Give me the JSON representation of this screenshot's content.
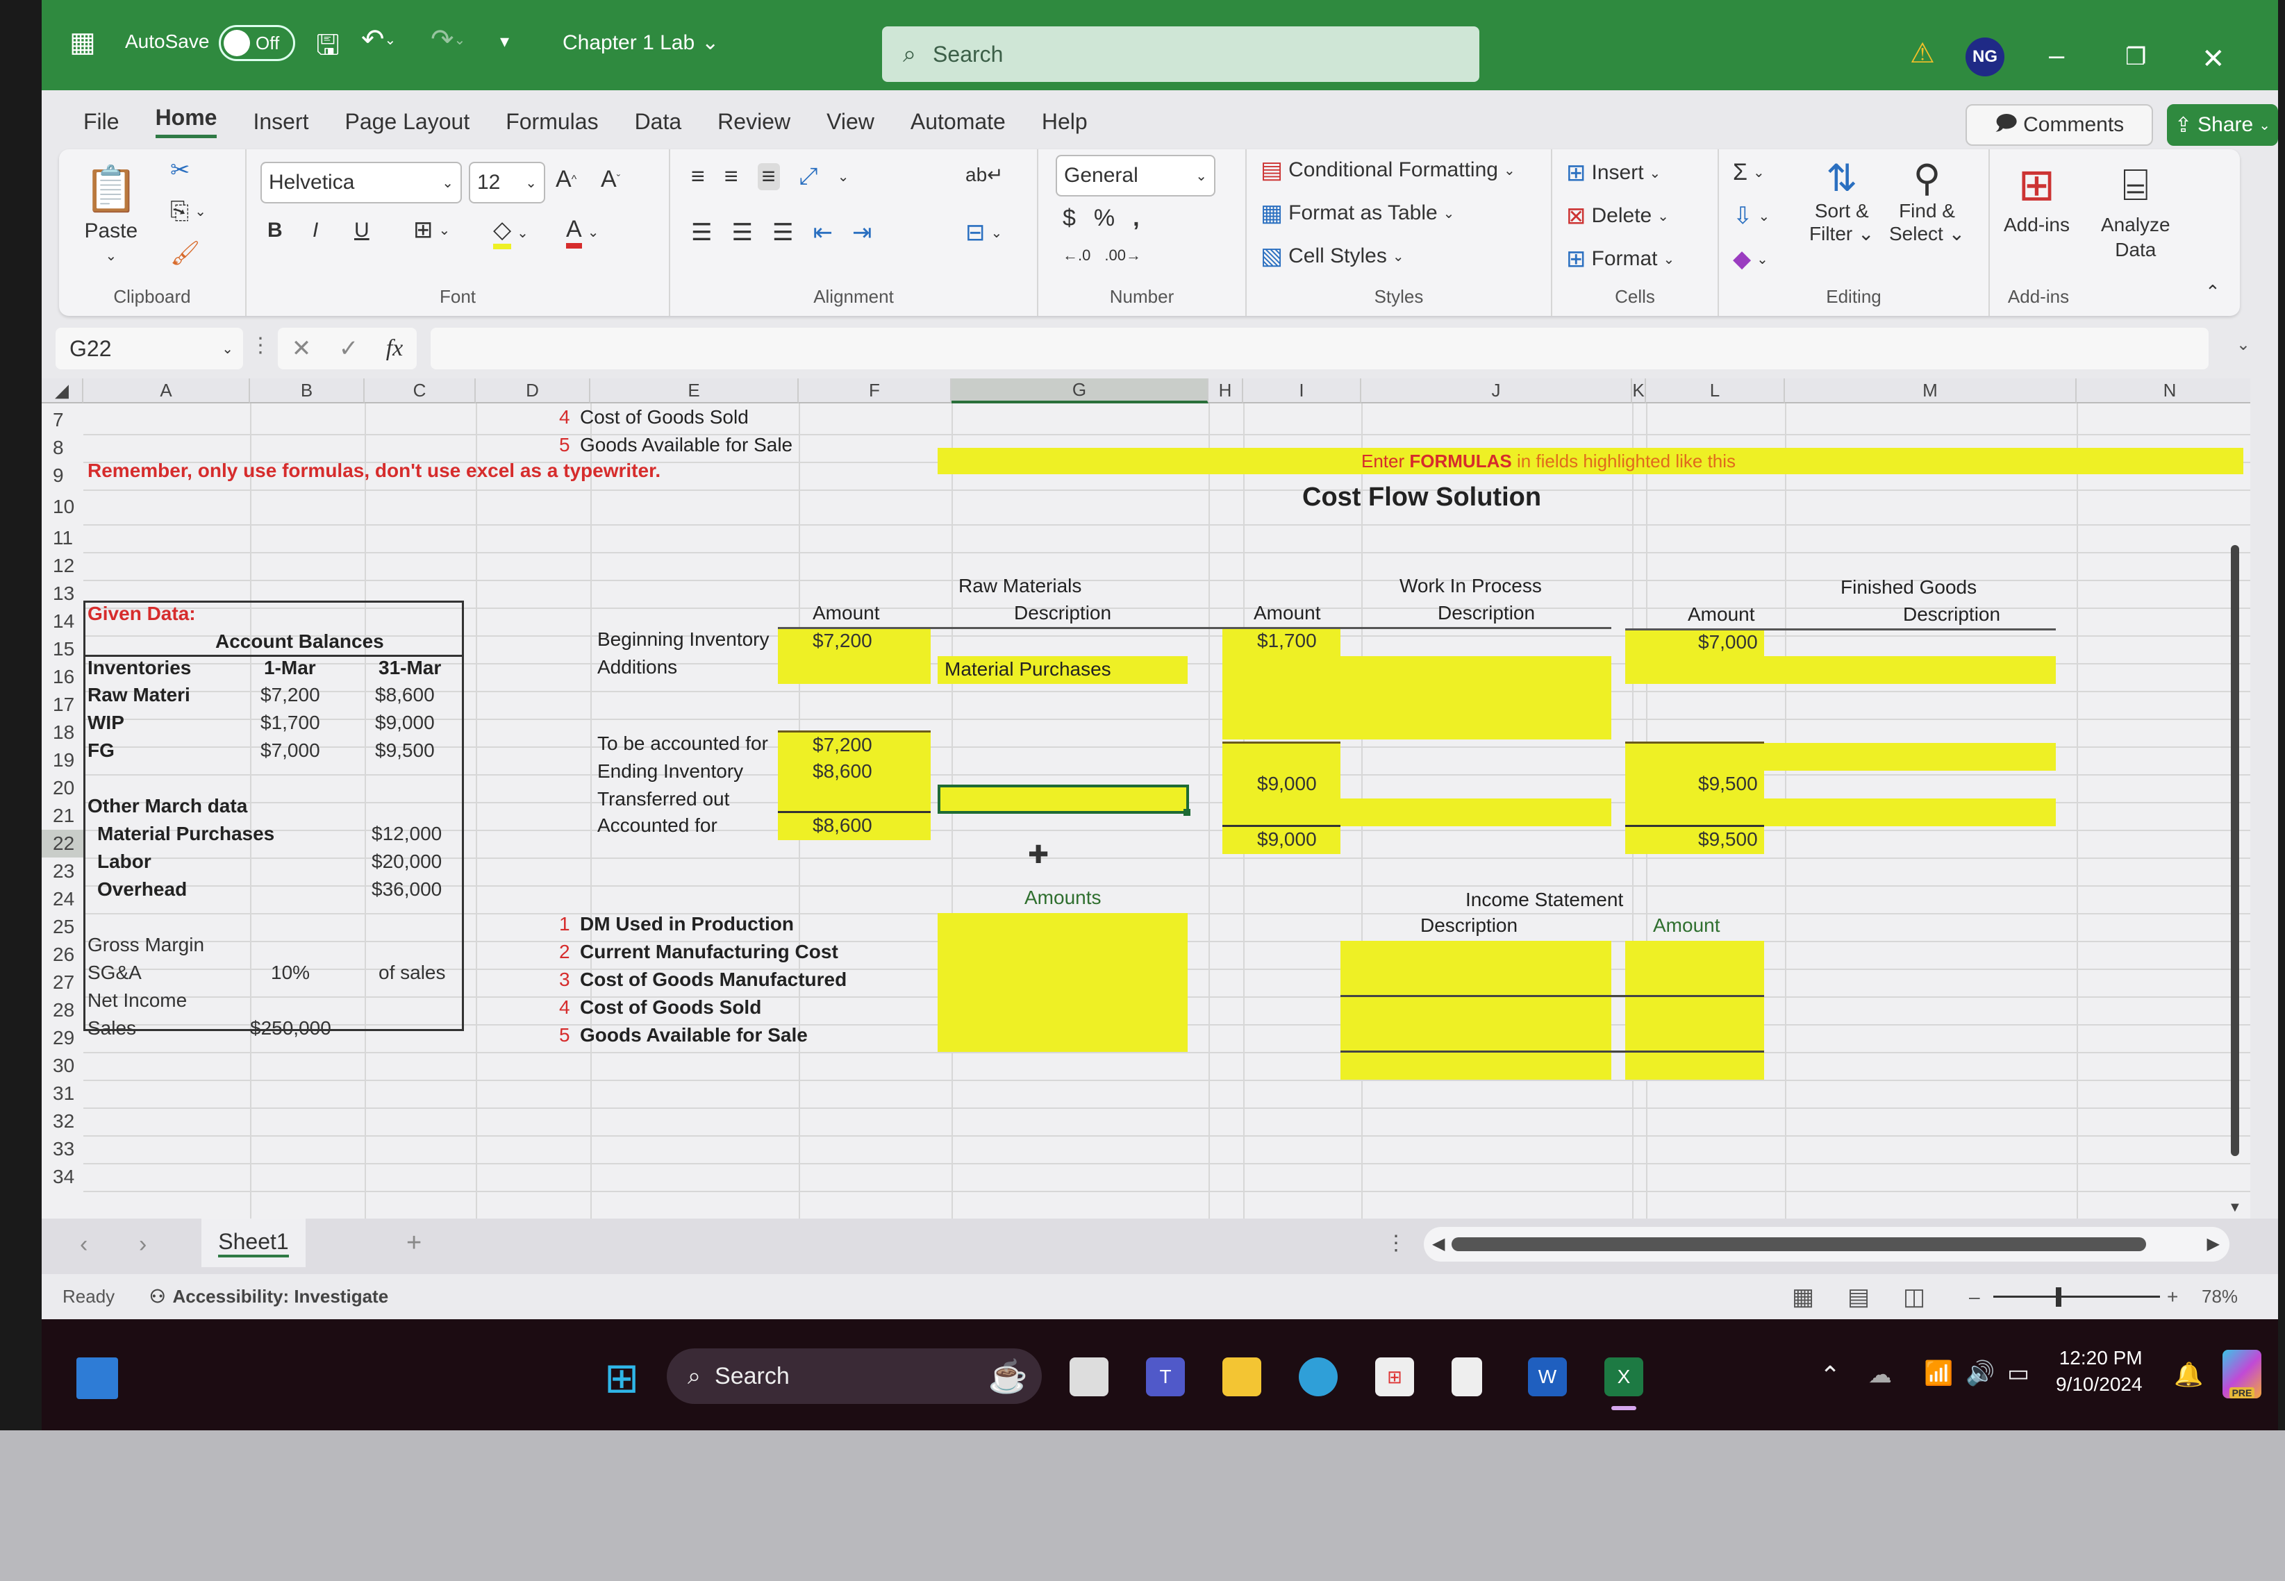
{
  "titlebar": {
    "autosave_label": "AutoSave",
    "autosave_state": "Off",
    "document_title": "Chapter 1 Lab",
    "search_placeholder": "Search",
    "user_initials": "NG",
    "icons": [
      "excel-logo-icon",
      "save-icon",
      "undo-icon",
      "redo-icon",
      "customize-qat-icon",
      "warning-icon",
      "minimize-icon",
      "restore-icon",
      "close-icon"
    ]
  },
  "menu": {
    "tabs": [
      "File",
      "Home",
      "Insert",
      "Page Layout",
      "Formulas",
      "Data",
      "Review",
      "View",
      "Automate",
      "Help"
    ],
    "active_tab": "Home",
    "comments_label": "Comments",
    "share_label": "Share"
  },
  "ribbon": {
    "clipboard": {
      "paste_label": "Paste",
      "group_label": "Clipboard"
    },
    "font": {
      "font_name": "Helvetica",
      "font_size": "12",
      "group_label": "Font",
      "bold": "B",
      "italic": "I",
      "underline": "U"
    },
    "alignment": {
      "group_label": "Alignment"
    },
    "number": {
      "format": "General",
      "currency": "$",
      "percent": "%",
      "comma": ",",
      "group_label": "Number"
    },
    "styles": {
      "conditional_formatting": "Conditional Formatting",
      "format_as_table": "Format as Table",
      "cell_styles": "Cell Styles",
      "group_label": "Styles"
    },
    "cells": {
      "insert": "Insert",
      "delete": "Delete",
      "format": "Format",
      "group_label": "Cells"
    },
    "editing": {
      "sort_filter_1": "Sort &",
      "sort_filter_2": "Filter",
      "find_select_1": "Find &",
      "find_select_2": "Select",
      "group_label": "Editing"
    },
    "addins": {
      "addins_label": "Add-ins",
      "analyze_1": "Analyze",
      "analyze_2": "Data",
      "group_label": "Add-ins"
    }
  },
  "formula_bar": {
    "name_box": "G22",
    "formula": ""
  },
  "grid": {
    "columns": [
      "A",
      "B",
      "C",
      "D",
      "E",
      "F",
      "G",
      "H",
      "I",
      "J",
      "K",
      "L",
      "M",
      "N"
    ],
    "selected_column": "G",
    "rows": [
      "7",
      "8",
      "9",
      "10",
      "11",
      "12",
      "13",
      "14",
      "15",
      "16",
      "17",
      "18",
      "19",
      "20",
      "21",
      "22",
      "23",
      "24",
      "25",
      "26",
      "27",
      "28",
      "29",
      "30",
      "31",
      "32",
      "33",
      "34"
    ],
    "selected_cell": "G22"
  },
  "sheet": {
    "top_list": [
      {
        "num": "4",
        "label": "Cost of Goods Sold"
      },
      {
        "num": "5",
        "label": "Goods Available for Sale"
      }
    ],
    "reminder": "Remember, only use formulas, don't use excel as a typewriter.",
    "banner_prefix": "Enter",
    "banner_bold": "FORMULAS",
    "banner_suffix": "in fields highlighted like this",
    "title": "Cost Flow Solution",
    "given": {
      "heading": "Given Data:",
      "account_balances": "Account Balances",
      "inventories_hdr": "Inventories",
      "col1": "1-Mar",
      "col2": "31-Mar",
      "rows": [
        {
          "label": "Raw Materi",
          "mar1": "$7,200",
          "mar31": "$8,600"
        },
        {
          "label": "WIP",
          "mar1": "$1,700",
          "mar31": "$9,000"
        },
        {
          "label": "FG",
          "mar1": "$7,000",
          "mar31": "$9,500"
        }
      ],
      "other_heading": "Other March data",
      "other": [
        {
          "label": "Material Purchases",
          "value": "$12,000"
        },
        {
          "label": "Labor",
          "value": "$20,000"
        },
        {
          "label": "Overhead",
          "value": "$36,000"
        }
      ],
      "gross_margin": "Gross Margin",
      "sga_label": "SG&A",
      "sga_pct": "10%",
      "sga_of": "of sales",
      "net_income": "Net Income",
      "sales_label": "Sales",
      "sales_value": "$250,000"
    },
    "flow_labels": {
      "beginning": "Beginning Inventory",
      "additions": "Additions",
      "to_be_accounted": "To be accounted for",
      "ending": "Ending Inventory",
      "transferred": "Transferred out",
      "accounted": "Accounted for"
    },
    "raw_materials": {
      "title": "Raw Materials",
      "amount_hdr": "Amount",
      "desc_hdr": "Description",
      "beginning": "$7,200",
      "additions_desc": "Material Purchases",
      "to_be_accounted": "$7,200",
      "ending": "$8,600",
      "accounted": "$8,600"
    },
    "wip": {
      "title": "Work In Process",
      "amount_hdr": "Amount",
      "desc_hdr": "Description",
      "beginning": "$1,700",
      "ending": "$9,000",
      "accounted": "$9,000"
    },
    "finished_goods": {
      "title": "Finished Goods",
      "amount_hdr": "Amount",
      "desc_hdr": "Description",
      "beginning": "$7,000",
      "ending": "$9,500",
      "accounted": "$9,500"
    },
    "amounts_hdr": "Amounts",
    "questions": [
      {
        "num": "1",
        "label": "DM Used in Production"
      },
      {
        "num": "2",
        "label": "Current Manufacturing Cost"
      },
      {
        "num": "3",
        "label": "Cost of Goods Manufactured"
      },
      {
        "num": "4",
        "label": "Cost of Goods Sold"
      },
      {
        "num": "5",
        "label": "Goods Available for Sale"
      }
    ],
    "income_statement": {
      "title": "Income Statement",
      "desc_hdr": "Description",
      "amount_hdr": "Amount"
    }
  },
  "sheet_tabs": {
    "active": "Sheet1",
    "add": "+"
  },
  "status": {
    "ready": "Ready",
    "accessibility": "Accessibility: Investigate",
    "zoom": "78%"
  },
  "taskbar": {
    "search_label": "Search",
    "time": "12:20 PM",
    "date": "9/10/2024",
    "copilot_badge": "PRE"
  },
  "colors": {
    "highlight": "#eef025",
    "titlebar": "#2f8a3f",
    "accent_red": "#d62c2c"
  }
}
